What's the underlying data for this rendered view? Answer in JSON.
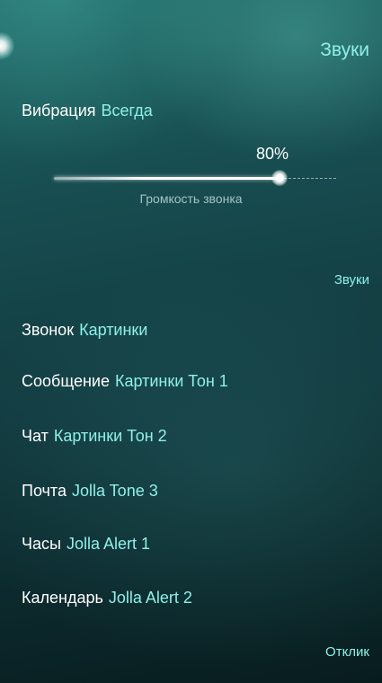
{
  "header": {
    "title": "Звуки"
  },
  "vibration": {
    "label": "Вибрация",
    "value": "Всегда"
  },
  "ringer_volume": {
    "value_text": "80%",
    "value": 0.8,
    "label": "Громкость звонка"
  },
  "sections": {
    "sounds": "Звуки",
    "feedback": "Отклик"
  },
  "sound_items": [
    {
      "label": "Звонок",
      "value": "Картинки"
    },
    {
      "label": "Сообщение",
      "value": "Картинки Тон 1"
    },
    {
      "label": "Чат",
      "value": "Картинки Тон 2"
    },
    {
      "label": "Почта",
      "value": "Jolla Tone 3"
    },
    {
      "label": "Часы",
      "value": "Jolla Alert 1"
    },
    {
      "label": "Календарь",
      "value": "Jolla Alert 2"
    }
  ],
  "colors": {
    "accent": "#8ff0ea",
    "text": "#ffffff"
  }
}
